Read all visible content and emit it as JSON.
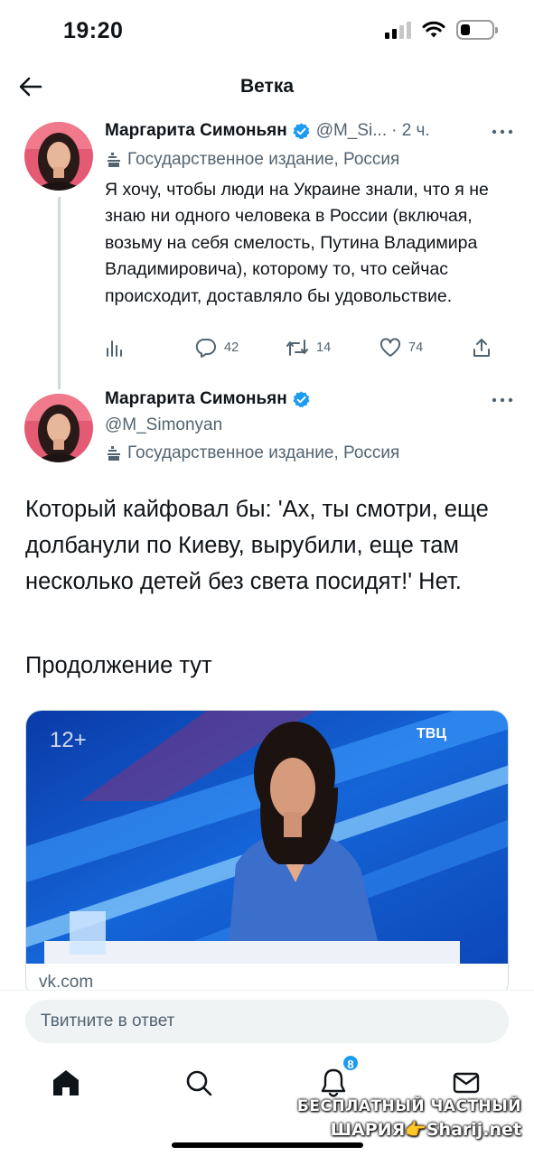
{
  "status_bar": {
    "time": "19:20"
  },
  "header": {
    "title": "Ветка"
  },
  "tweet1": {
    "name": "Маргарита Симоньян",
    "handle": "@M_Si...",
    "time": "· 2 ч.",
    "label": "Государственное издание, Россия",
    "text": "Я хочу, чтобы люди на Украине знали, что я не знаю ни одного человека в России (включая, возьму на себя смелость, Путина Владимира Владимировича), которому то, что сейчас происходит, доставляло бы удовольствие.",
    "replies": "42",
    "retweets": "14",
    "likes": "74"
  },
  "tweet2": {
    "name": "Маргарита Симоньян",
    "handle": "@M_Simonyan",
    "label": "Государственное издание, Россия",
    "text": "Который кайфовал бы: 'Ах, ты смотри, еще долбанули по Киеву, вырубили, еще там несколько детей без света посидят!' Нет.",
    "continue": "Продолжение тут",
    "card": {
      "age_rating": "12+",
      "channel": "ТВЦ",
      "domain": "vk.com"
    }
  },
  "reply": {
    "placeholder": "Твитните в ответ"
  },
  "tabbar": {
    "notifications_badge": "8"
  },
  "watermark": {
    "line1": "БЕСПЛАТНЫЙ ЧАСТНЫЙ",
    "line2": "ШАРИЯ👉Sharij.net"
  },
  "colors": {
    "accent": "#1d9bf0",
    "text": "#0f1419",
    "secondary": "#536471"
  },
  "icons": [
    "back-arrow-icon",
    "verified-icon",
    "more-icon",
    "state-media-icon",
    "views-icon",
    "reply-icon",
    "retweet-icon",
    "like-icon",
    "share-icon",
    "home-icon",
    "search-icon",
    "notifications-icon",
    "messages-icon"
  ]
}
